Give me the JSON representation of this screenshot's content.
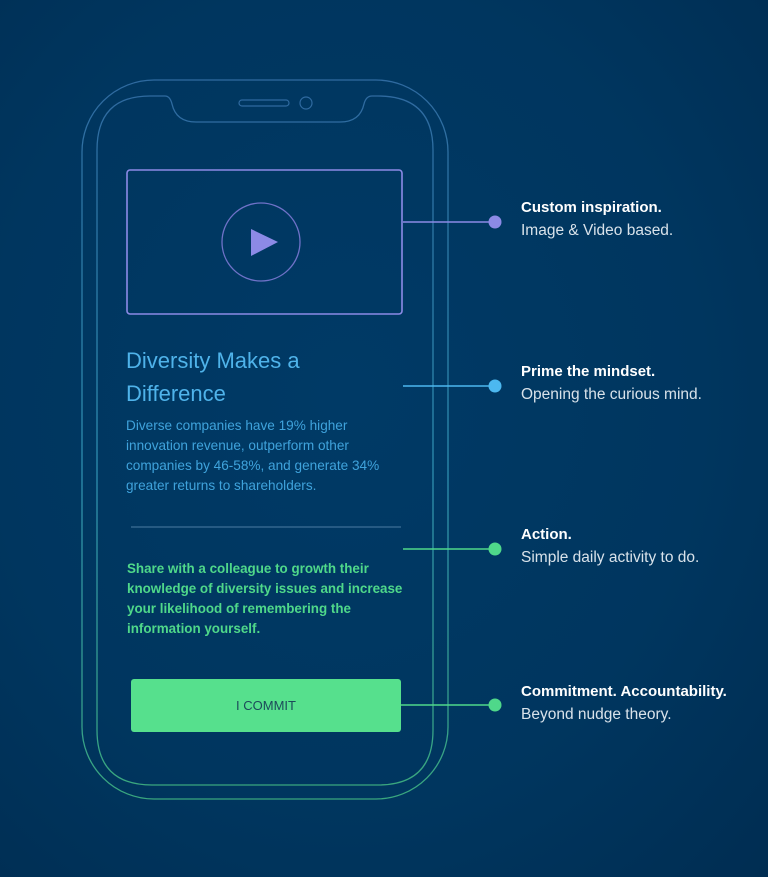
{
  "colors": {
    "background": "#00365f",
    "video": "#8c8ae6",
    "prime": "#4cb8f0",
    "action": "#4fd88a",
    "commit_button": "#56e08d"
  },
  "phone": {
    "video": {
      "icon": "play-icon"
    },
    "title": "Diversity Makes a Difference",
    "body": "Diverse companies have 19% higher innovation revenue, outperform other companies by 46-58%, and generate 34% greater returns to shareholders.",
    "action": "Share with a colleague to growth their knowledge of diversity issues and increase your likelihood of remembering the information yourself.",
    "commit_label": "I COMMIT"
  },
  "callouts": [
    {
      "title": "Custom inspiration.",
      "subtitle": "Image & Video based."
    },
    {
      "title": "Prime the mindset.",
      "subtitle": "Opening the curious mind."
    },
    {
      "title": "Action.",
      "subtitle": "Simple daily activity to do."
    },
    {
      "title": "Commitment. Accountability.",
      "subtitle": "Beyond nudge theory."
    }
  ]
}
